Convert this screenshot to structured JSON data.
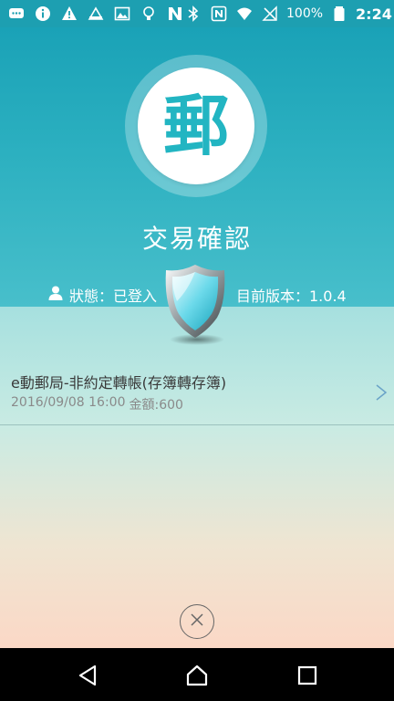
{
  "status_bar": {
    "battery": "100%",
    "time": "2:24",
    "icons": [
      "chat-bubble-icon",
      "info-icon",
      "warning-icon",
      "photos-icon",
      "image-icon",
      "lightbulb-icon",
      "n-badge-icon",
      "bluetooth-icon",
      "nfc-icon",
      "wifi-icon",
      "no-signal-icon",
      "battery-icon"
    ]
  },
  "header": {
    "logo_char": "郵",
    "title": "交易確認",
    "status_label": "狀態：已登入",
    "version_label": "目前版本：1.0.4"
  },
  "transaction": {
    "title": "e動郵局-非約定轉帳(存簿轉存簿)",
    "datetime": "2016/09/08 16:00",
    "amount": "金額:600"
  },
  "colors": {
    "header_teal": "#1aa2b7",
    "logo_teal": "#22b5c2",
    "nav_bg": "#000000"
  }
}
